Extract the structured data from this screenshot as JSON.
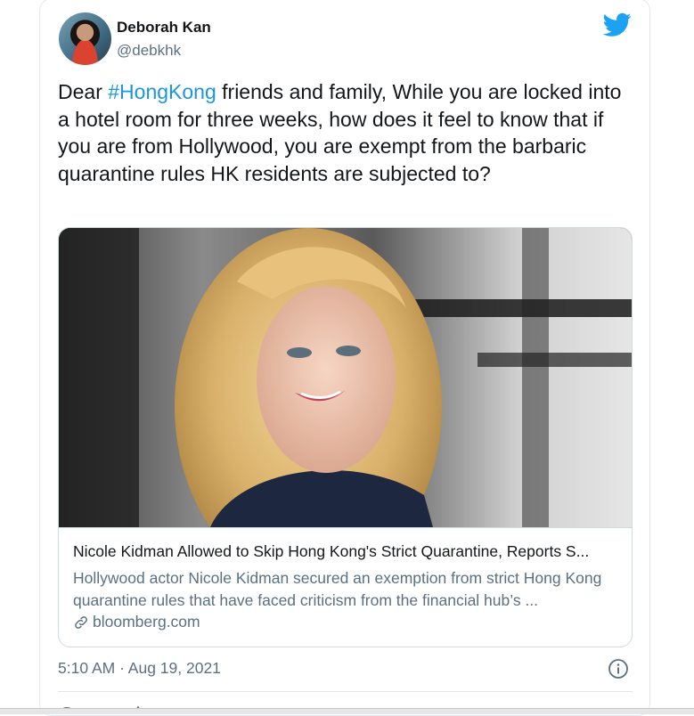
{
  "tweet": {
    "display_name": "Deborah Kan",
    "handle": "@debkhk",
    "text_prefix": "Dear ",
    "hashtag": "#HongKong",
    "text_suffix": " friends and family, While you are locked into a hotel room for three weeks, how does it feel to know that if you are from Hollywood, you are exempt from the barbaric quarantine rules HK residents are subjected to?",
    "timestamp": "5:10 AM · Aug 19, 2021"
  },
  "card": {
    "title": "Nicole Kidman Allowed to Skip Hong Kong's Strict Quarantine, Reports S...",
    "description": "Hollywood actor Nicole Kidman secured an exemption from strict Hong Kong quarantine rules that have faced criticism from the financial hub’s ...",
    "domain": "bloomberg.com"
  },
  "icons": {
    "brand": "twitter-bird-icon",
    "link": "link-icon",
    "info": "info-icon"
  },
  "colors": {
    "hashtag": "#1b95e0",
    "twitter_blue": "#1da1f2",
    "secondary_text": "#5b7083",
    "primary_text": "#14171a"
  }
}
